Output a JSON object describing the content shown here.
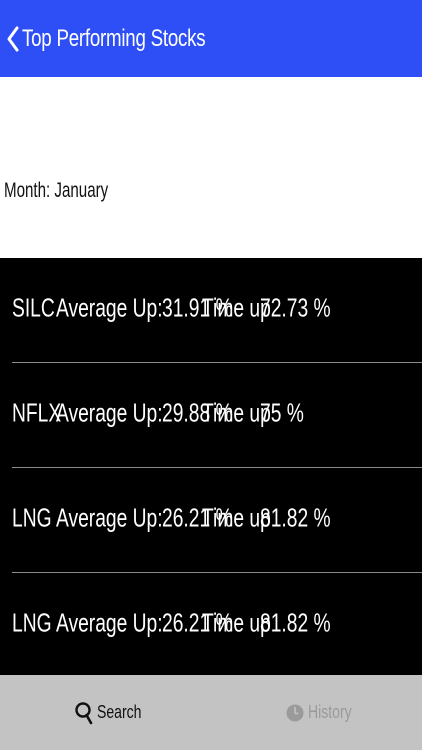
{
  "nav": {
    "back_icon": "chevron-left-icon",
    "title": "Top Performing Stocks",
    "background": "#2d4ff5"
  },
  "month": {
    "label": "Month: January"
  },
  "stocks": [
    {
      "symbol": "SILC",
      "avg_label": "Average Up:",
      "avg_value": "31.91 %",
      "time_label": "Time up",
      "time_value": "72.73 %"
    },
    {
      "symbol": "NFLX",
      "avg_label": "Average Up:",
      "avg_value": "29.88 %",
      "time_label": "Time up",
      "time_value": "75 %"
    },
    {
      "symbol": "LNG",
      "avg_label": "Average Up:",
      "avg_value": "26.21 %",
      "time_label": "Time up",
      "time_value": "81.82 %"
    },
    {
      "symbol": "LNG",
      "avg_label": "Average Up:",
      "avg_value": "26.21 %",
      "time_label": "Time up",
      "time_value": "81.82 %"
    }
  ],
  "tabs": [
    {
      "label": "Search",
      "icon": "search-icon",
      "selected": true
    },
    {
      "label": "History",
      "icon": "clock-icon",
      "selected": false
    }
  ]
}
